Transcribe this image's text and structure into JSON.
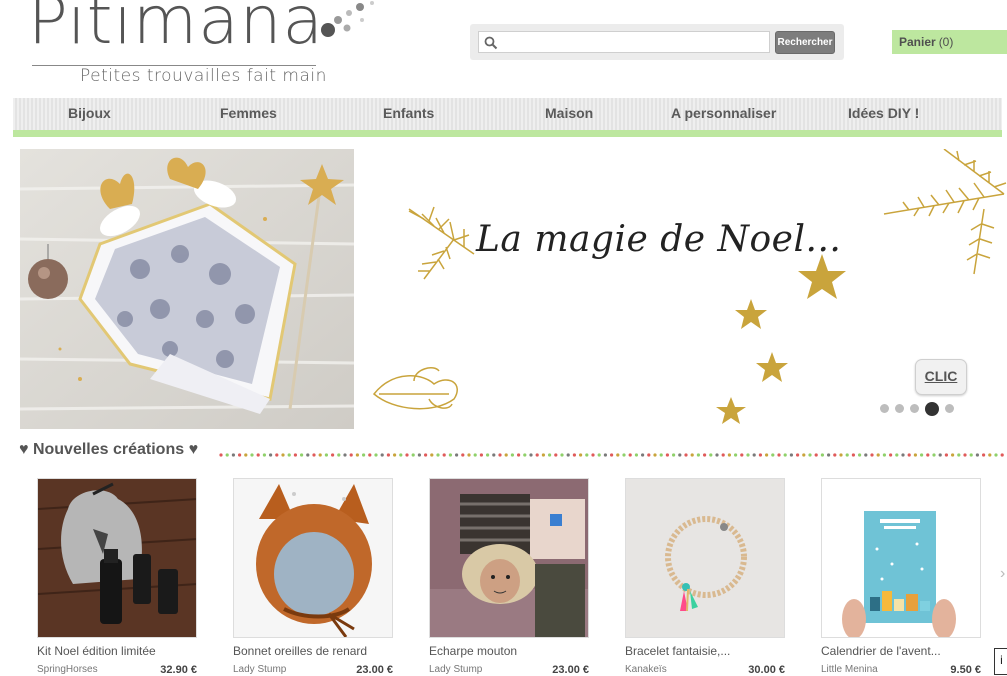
{
  "logo": {
    "title": "Pitimana",
    "tagline": "Petites trouvailles fait main"
  },
  "search": {
    "placeholder": "",
    "value": "",
    "button_label": "Rechercher"
  },
  "cart": {
    "label": "Panier",
    "count": "(0)"
  },
  "nav": {
    "items": [
      {
        "label": "Bijoux"
      },
      {
        "label": "Femmes"
      },
      {
        "label": "Enfants"
      },
      {
        "label": "Maison"
      },
      {
        "label": "A personnaliser"
      },
      {
        "label": "Idées DIY !"
      }
    ]
  },
  "banner": {
    "headline": "La magie de Noel...",
    "clic_label": "CLIC",
    "slide_count": 5,
    "active_slide": 4
  },
  "section": {
    "title": "♥ Nouvelles créations ♥"
  },
  "products": [
    {
      "name": "Kit Noel édition limitée",
      "seller": "SpringHorses",
      "price": "32.90 €"
    },
    {
      "name": "Bonnet oreilles de renard",
      "seller": "Lady Stump",
      "price": "23.00 €"
    },
    {
      "name": "Echarpe mouton",
      "seller": "Lady Stump",
      "price": "23.00 €"
    },
    {
      "name": "Bracelet fantaisie,...",
      "seller": "Kanakeïs",
      "price": "30.00 €"
    },
    {
      "name": "Calendrier de l'avent...",
      "seller": "Little Menina",
      "price": "9.50 €"
    }
  ],
  "colors": {
    "accent_green": "#bde79f",
    "gold": "#c9a43c",
    "button_grey": "#7d7d7d"
  },
  "help_tab": {
    "label": "i"
  }
}
